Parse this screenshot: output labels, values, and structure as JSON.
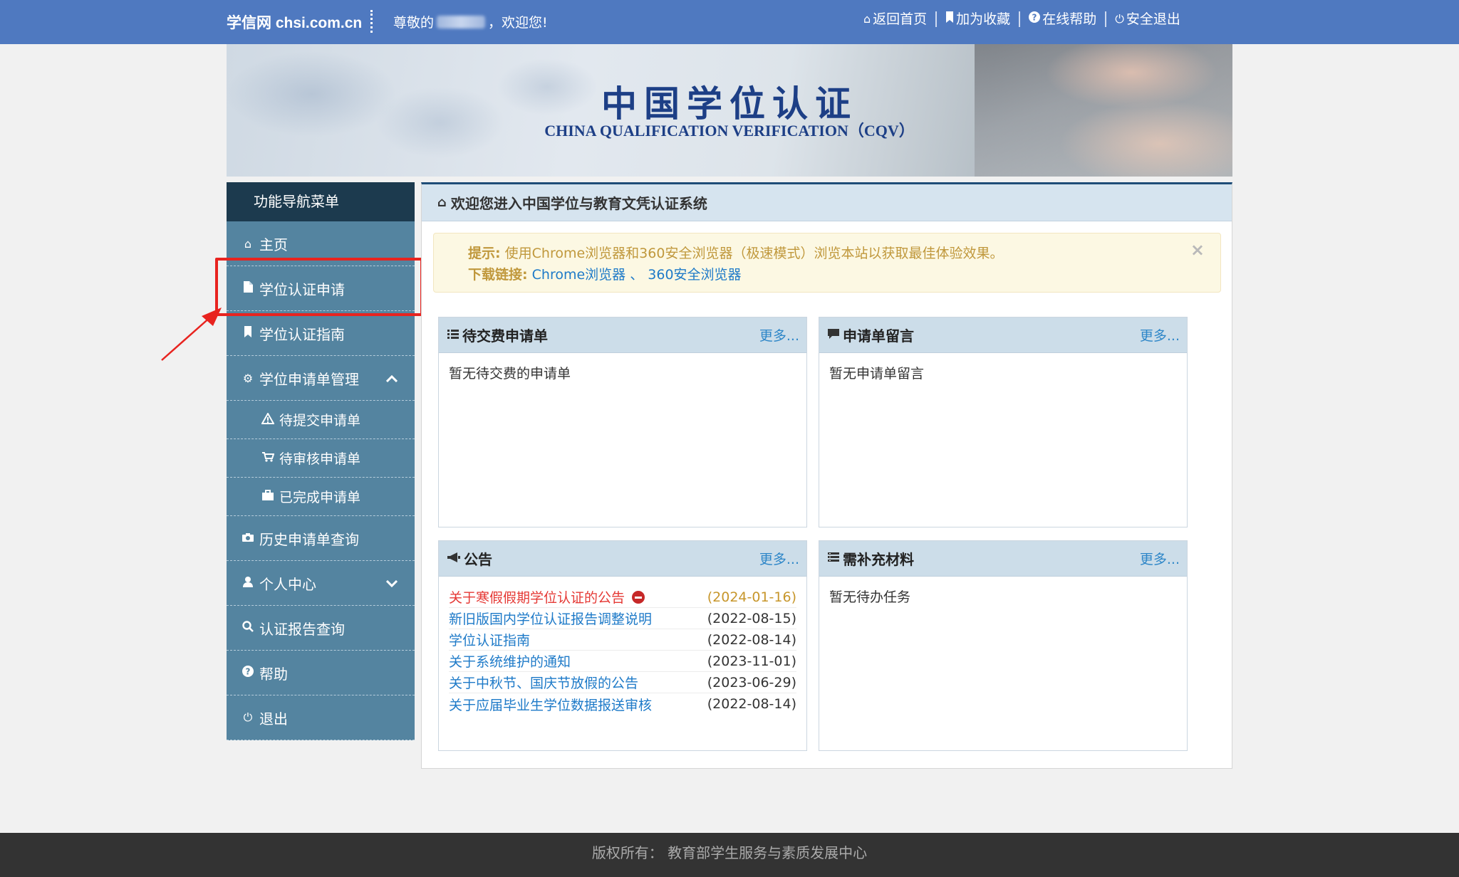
{
  "topbar": {
    "brand": "学信网 chsi.com.cn",
    "greeting_prefix": "尊敬的",
    "greeting_suffix": "，欢迎您!",
    "links": [
      {
        "icon": "home-icon",
        "label": "返回首页"
      },
      {
        "icon": "bookmark-icon",
        "label": "加为收藏"
      },
      {
        "icon": "question-icon",
        "label": "在线帮助"
      },
      {
        "icon": "power-icon",
        "label": "安全退出"
      }
    ]
  },
  "banner": {
    "title_cn": "中国学位认证",
    "title_en": "CHINA QUALIFICATION VERIFICATION（CQV）"
  },
  "sidebar": {
    "header": "功能导航菜单",
    "items": [
      {
        "icon": "home-icon",
        "label": "主页"
      },
      {
        "icon": "file-icon",
        "label": "学位认证申请"
      },
      {
        "icon": "bookmark-icon",
        "label": "学位认证指南"
      },
      {
        "icon": "gear-icon",
        "label": "学位申请单管理",
        "expanded": true
      },
      {
        "icon": "warning-icon",
        "label": "待提交申请单"
      },
      {
        "icon": "cart-icon",
        "label": "待审核申请单"
      },
      {
        "icon": "briefcase-icon",
        "label": "已完成申请单"
      },
      {
        "icon": "camera-icon",
        "label": "历史申请单查询"
      },
      {
        "icon": "user-icon",
        "label": "个人中心",
        "expanded": false
      },
      {
        "icon": "search-icon",
        "label": "认证报告查询"
      },
      {
        "icon": "question-icon",
        "label": "帮助"
      },
      {
        "icon": "power-icon",
        "label": "退出"
      }
    ]
  },
  "main": {
    "title": "欢迎您进入中国学位与教育文凭认证系统",
    "alert": {
      "tip_label": "提示:",
      "tip_text": " 使用Chrome浏览器和360安全浏览器（极速模式）浏览本站以获取最佳体验效果。",
      "download_label": "下载链接:",
      "link_chrome": "Chrome浏览器",
      "link_sep": " 、",
      "link_360": "360安全浏览器"
    },
    "more_label": "更多...",
    "panel_pending_fee": {
      "title": "待交费申请单",
      "empty": "暂无待交费的申请单"
    },
    "panel_messages": {
      "title": "申请单留言",
      "empty": "暂无申请单留言"
    },
    "panel_notices": {
      "title": "公告",
      "items": [
        {
          "title": "关于寒假假期学位认证的公告",
          "date": "(2024-01-16)",
          "hot": true
        },
        {
          "title": "新旧版国内学位认证报告调整说明",
          "date": "(2022-08-15)"
        },
        {
          "title": "学位认证指南",
          "date": "(2022-08-14)"
        },
        {
          "title": "关于系统维护的通知",
          "date": "(2023-11-01)"
        },
        {
          "title": "关于中秋节、国庆节放假的公告",
          "date": "(2023-06-29)"
        },
        {
          "title": "关于应届毕业生学位数据报送审核",
          "date": "(2022-08-14)"
        }
      ]
    },
    "panel_materials": {
      "title": "需补充材料",
      "empty": "暂无待办任务"
    }
  },
  "footer": {
    "copyright": "版权所有： 教育部学生服务与素质发展中心"
  },
  "colors": {
    "topbar": "#4f79c0",
    "sidebar_item": "#5484a0",
    "sidebar_header": "#1c3a4e",
    "highlight": "#e8231f",
    "link": "#1e7ac8"
  }
}
